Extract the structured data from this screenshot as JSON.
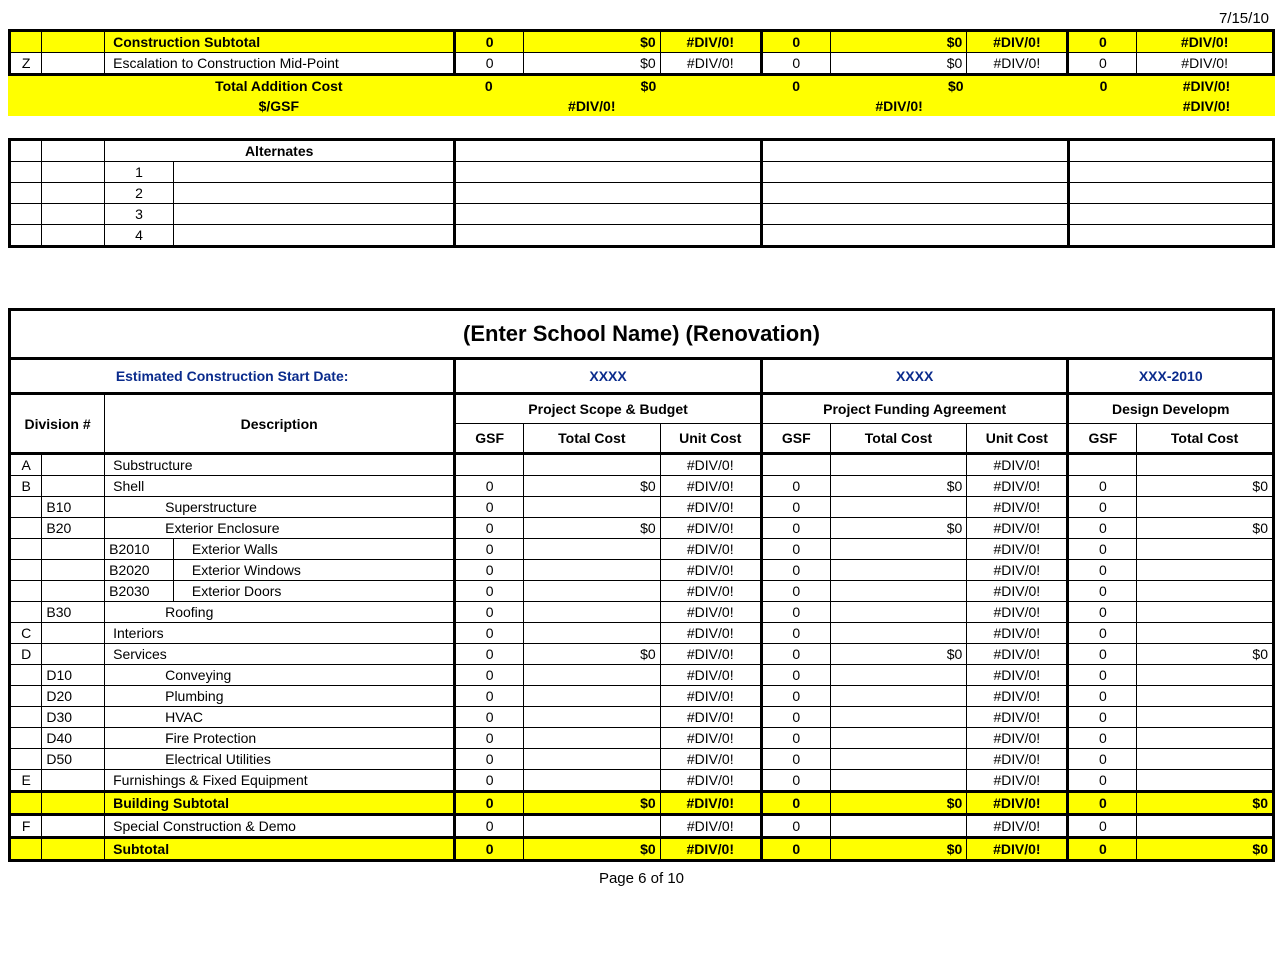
{
  "header_date": "7/15/10",
  "top": {
    "construction_subtotal": "Construction Subtotal",
    "escalation_code": "Z",
    "escalation_label": "Escalation to Construction Mid-Point",
    "total_addition_label": "Total Addition Cost",
    "gsf_label": "$/GSF",
    "vals": {
      "cs": [
        "0",
        "$0",
        "#DIV/0!",
        "0",
        "$0",
        "#DIV/0!",
        "0",
        "#DIV/0!"
      ],
      "esc": [
        "0",
        "$0",
        "#DIV/0!",
        "0",
        "$0",
        "#DIV/0!",
        "0",
        "#DIV/0!"
      ],
      "tac": [
        "0",
        "$0",
        "",
        "0",
        "$0",
        "",
        "0",
        "#DIV/0!"
      ],
      "gsf": [
        "",
        "#DIV/0!",
        "",
        "",
        "#DIV/0!",
        "",
        "",
        "#DIV/0!"
      ]
    }
  },
  "alternates": {
    "title": "Alternates",
    "rows": [
      "1",
      "2",
      "3",
      "4"
    ]
  },
  "school": {
    "title": "(Enter School Name) (Renovation)",
    "start_label": "Estimated Construction Start Date:",
    "dates": [
      "XXXX",
      "XXXX",
      "XXX-2010"
    ],
    "groups": [
      "Project Scope & Budget",
      "Project Funding Agreement",
      "Design Developm"
    ],
    "division_label": "Division #",
    "description_label": "Description",
    "sub": [
      "GSF",
      "Total Cost",
      "Unit Cost"
    ],
    "rows": [
      {
        "a": "A",
        "b": "",
        "c": "",
        "d": "Substructure",
        "ind": "ind1",
        "v": [
          "",
          "",
          "#DIV/0!",
          "",
          "",
          "#DIV/0!",
          "",
          ""
        ]
      },
      {
        "a": "B",
        "b": "",
        "c": "",
        "d": "Shell",
        "ind": "ind1",
        "v": [
          "0",
          "$0",
          "#DIV/0!",
          "0",
          "$0",
          "#DIV/0!",
          "0",
          "$0"
        ]
      },
      {
        "a": "",
        "b": "B10",
        "c": "",
        "d": "Superstructure",
        "ind": "ind2",
        "v": [
          "0",
          "",
          "#DIV/0!",
          "0",
          "",
          "#DIV/0!",
          "0",
          ""
        ]
      },
      {
        "a": "",
        "b": "B20",
        "c": "",
        "d": "Exterior Enclosure",
        "ind": "ind2",
        "v": [
          "0",
          "$0",
          "#DIV/0!",
          "0",
          "$0",
          "#DIV/0!",
          "0",
          "$0"
        ]
      },
      {
        "a": "",
        "b": "",
        "c": "B2010",
        "d": "Exterior Walls",
        "ind": "ind3",
        "v": [
          "0",
          "",
          "#DIV/0!",
          "0",
          "",
          "#DIV/0!",
          "0",
          ""
        ]
      },
      {
        "a": "",
        "b": "",
        "c": "B2020",
        "d": "Exterior Windows",
        "ind": "ind3",
        "v": [
          "0",
          "",
          "#DIV/0!",
          "0",
          "",
          "#DIV/0!",
          "0",
          ""
        ]
      },
      {
        "a": "",
        "b": "",
        "c": "B2030",
        "d": "Exterior Doors",
        "ind": "ind3",
        "v": [
          "0",
          "",
          "#DIV/0!",
          "0",
          "",
          "#DIV/0!",
          "0",
          ""
        ]
      },
      {
        "a": "",
        "b": "B30",
        "c": "",
        "d": "Roofing",
        "ind": "ind2",
        "v": [
          "0",
          "",
          "#DIV/0!",
          "0",
          "",
          "#DIV/0!",
          "0",
          ""
        ]
      },
      {
        "a": "C",
        "b": "",
        "c": "",
        "d": "Interiors",
        "ind": "ind1",
        "v": [
          "0",
          "",
          "#DIV/0!",
          "0",
          "",
          "#DIV/0!",
          "0",
          ""
        ]
      },
      {
        "a": "D",
        "b": "",
        "c": "",
        "d": "Services",
        "ind": "ind1",
        "v": [
          "0",
          "$0",
          "#DIV/0!",
          "0",
          "$0",
          "#DIV/0!",
          "0",
          "$0"
        ]
      },
      {
        "a": "",
        "b": "D10",
        "c": "",
        "d": "Conveying",
        "ind": "ind2",
        "v": [
          "0",
          "",
          "#DIV/0!",
          "0",
          "",
          "#DIV/0!",
          "0",
          ""
        ]
      },
      {
        "a": "",
        "b": "D20",
        "c": "",
        "d": "Plumbing",
        "ind": "ind2",
        "v": [
          "0",
          "",
          "#DIV/0!",
          "0",
          "",
          "#DIV/0!",
          "0",
          ""
        ]
      },
      {
        "a": "",
        "b": "D30",
        "c": "",
        "d": "HVAC",
        "ind": "ind2",
        "v": [
          "0",
          "",
          "#DIV/0!",
          "0",
          "",
          "#DIV/0!",
          "0",
          ""
        ]
      },
      {
        "a": "",
        "b": "D40",
        "c": "",
        "d": "Fire Protection",
        "ind": "ind2",
        "v": [
          "0",
          "",
          "#DIV/0!",
          "0",
          "",
          "#DIV/0!",
          "0",
          ""
        ]
      },
      {
        "a": "",
        "b": "D50",
        "c": "",
        "d": "Electrical Utilities",
        "ind": "ind2",
        "v": [
          "0",
          "",
          "#DIV/0!",
          "0",
          "",
          "#DIV/0!",
          "0",
          ""
        ]
      },
      {
        "a": "E",
        "b": "",
        "c": "",
        "d": "Furnishings & Fixed Equipment",
        "ind": "ind1",
        "v": [
          "0",
          "",
          "#DIV/0!",
          "0",
          "",
          "#DIV/0!",
          "0",
          ""
        ]
      }
    ],
    "building_subtotal": {
      "label": "Building Subtotal",
      "v": [
        "0",
        "$0",
        "#DIV/0!",
        "0",
        "$0",
        "#DIV/0!",
        "0",
        "$0"
      ]
    },
    "f_row": {
      "a": "F",
      "d": "Special Construction & Demo",
      "v": [
        "0",
        "",
        "#DIV/0!",
        "0",
        "",
        "#DIV/0!",
        "0",
        ""
      ]
    },
    "subtotal": {
      "label": "Subtotal",
      "v": [
        "0",
        "$0",
        "#DIV/0!",
        "0",
        "$0",
        "#DIV/0!",
        "0",
        "$0"
      ]
    }
  },
  "footer": "Page 6 of 10"
}
